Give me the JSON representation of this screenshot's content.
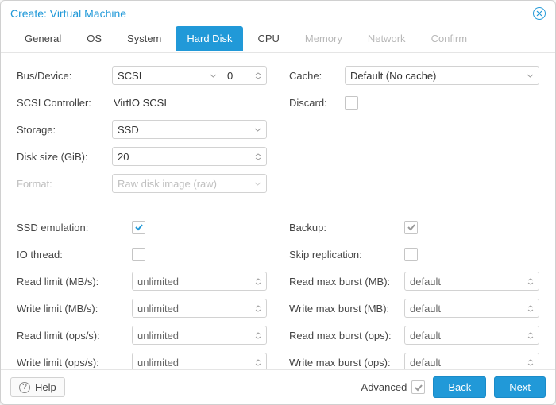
{
  "title": "Create: Virtual Machine",
  "tabs": [
    "General",
    "OS",
    "System",
    "Hard Disk",
    "CPU",
    "Memory",
    "Network",
    "Confirm"
  ],
  "active_tab": 3,
  "left": {
    "bus_device_label": "Bus/Device:",
    "bus_device_type": "SCSI",
    "bus_device_num": "0",
    "scsi_ctrl_label": "SCSI Controller:",
    "scsi_ctrl_value": "VirtIO SCSI",
    "storage_label": "Storage:",
    "storage_value": "SSD",
    "disk_size_label": "Disk size (GiB):",
    "disk_size_value": "20",
    "format_label": "Format:",
    "format_value": "Raw disk image (raw)"
  },
  "right": {
    "cache_label": "Cache:",
    "cache_value": "Default (No cache)",
    "discard_label": "Discard:"
  },
  "adv_left": {
    "ssd_emu_label": "SSD emulation:",
    "io_thread_label": "IO thread:",
    "read_limit_mb_label": "Read limit (MB/s):",
    "write_limit_mb_label": "Write limit (MB/s):",
    "read_limit_ops_label": "Read limit (ops/s):",
    "write_limit_ops_label": "Write limit (ops/s):",
    "unlimited": "unlimited"
  },
  "adv_right": {
    "backup_label": "Backup:",
    "skip_repl_label": "Skip replication:",
    "read_burst_mb_label": "Read max burst (MB):",
    "write_burst_mb_label": "Write max burst (MB):",
    "read_burst_ops_label": "Read max burst (ops):",
    "write_burst_ops_label": "Write max burst (ops):",
    "default": "default"
  },
  "footer": {
    "help": "Help",
    "advanced": "Advanced",
    "back": "Back",
    "next": "Next"
  }
}
